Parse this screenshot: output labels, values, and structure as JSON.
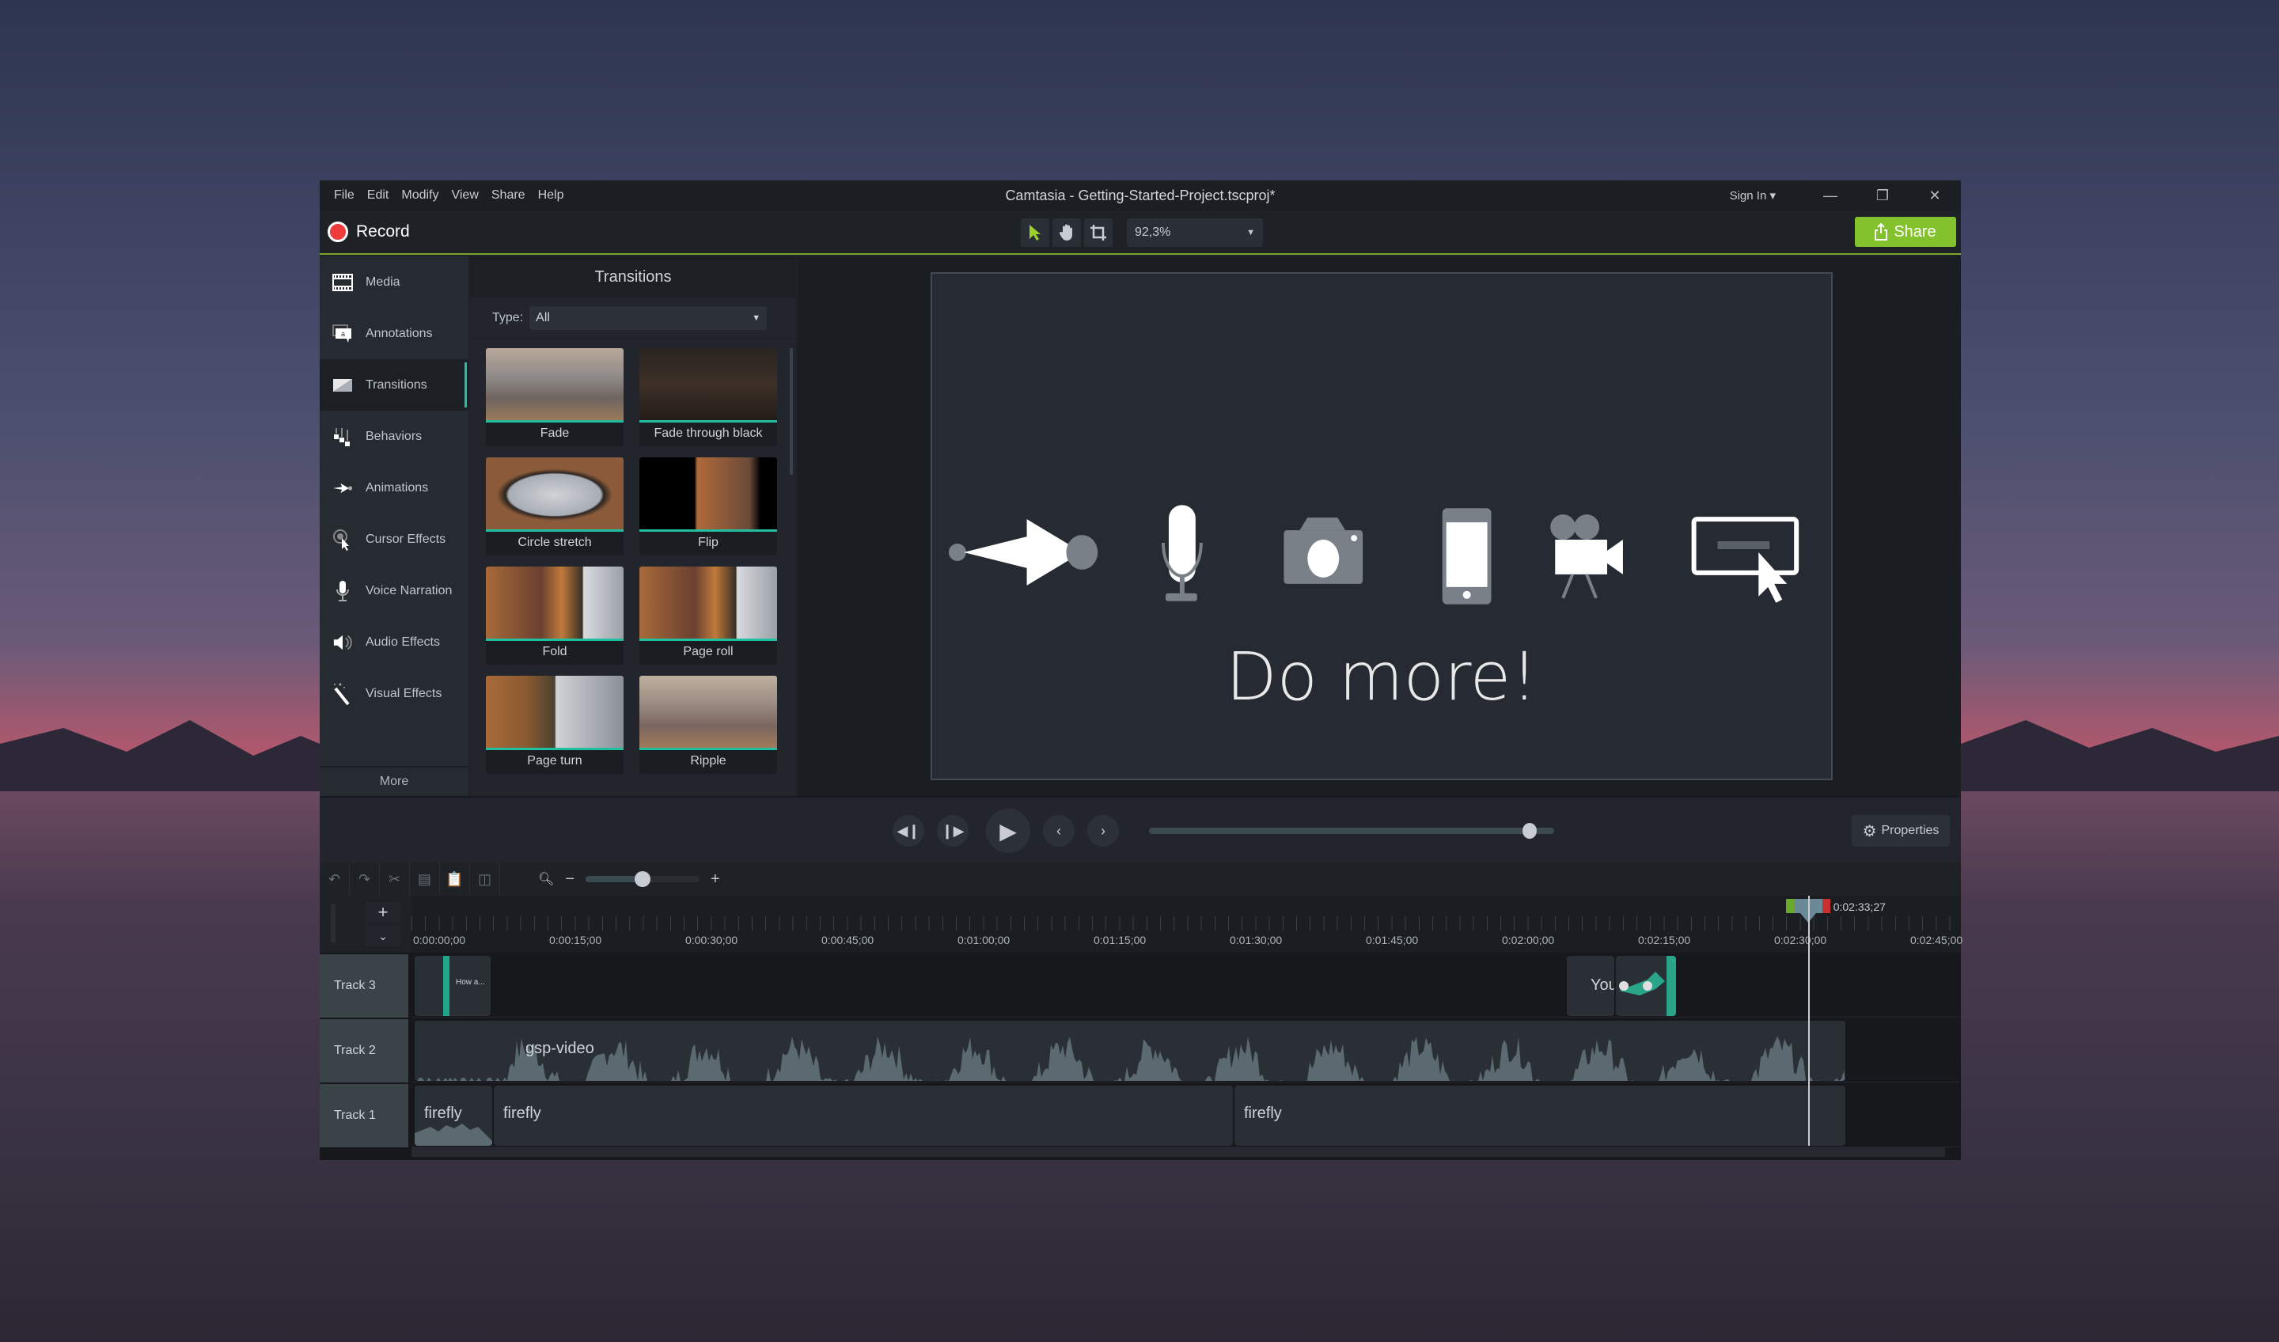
{
  "window": {
    "title": "Camtasia - Getting-Started-Project.tscproj*",
    "menu": [
      "File",
      "Edit",
      "Modify",
      "View",
      "Share",
      "Help"
    ],
    "sign_in": "Sign In ▾",
    "minimize": "—",
    "restore": "❐",
    "close": "✕"
  },
  "toolbar": {
    "record_label": "Record",
    "zoom_value": "92,3%",
    "share_label": "Share",
    "accent_color": "#83c22c"
  },
  "sidebar": {
    "items": [
      {
        "label": "Media",
        "icon": "media-icon"
      },
      {
        "label": "Annotations",
        "icon": "annotations-icon"
      },
      {
        "label": "Transitions",
        "icon": "transitions-icon",
        "active": true
      },
      {
        "label": "Behaviors",
        "icon": "behaviors-icon"
      },
      {
        "label": "Animations",
        "icon": "animations-icon"
      },
      {
        "label": "Cursor Effects",
        "icon": "cursor-effects-icon"
      },
      {
        "label": "Voice Narration",
        "icon": "microphone-icon"
      },
      {
        "label": "Audio Effects",
        "icon": "speaker-icon"
      },
      {
        "label": "Visual Effects",
        "icon": "magic-wand-icon"
      }
    ],
    "more_label": "More"
  },
  "panel": {
    "title": "Transitions",
    "type_label": "Type:",
    "type_value": "All",
    "items": [
      {
        "label": "Fade"
      },
      {
        "label": "Fade through black"
      },
      {
        "label": "Circle stretch"
      },
      {
        "label": "Flip"
      },
      {
        "label": "Fold"
      },
      {
        "label": "Page roll"
      },
      {
        "label": "Page turn"
      },
      {
        "label": "Ripple"
      }
    ]
  },
  "canvas": {
    "headline": "Do more!",
    "icons": [
      "arrow-icon",
      "microphone-icon",
      "camera-icon",
      "phone-icon",
      "video-camera-icon",
      "screen-cursor-icon"
    ]
  },
  "playback": {
    "properties_label": "Properties",
    "scrub_fraction": 0.94
  },
  "timeline": {
    "zoom_fraction": 0.5,
    "playhead_time": "0:02:33;27",
    "ruler_labels": [
      "0:00:00;00",
      "0:00:15;00",
      "0:00:30;00",
      "0:00:45;00",
      "0:01:00;00",
      "0:01:15;00",
      "0:01:30;00",
      "0:01:45;00",
      "0:02:00;00",
      "0:02:15;00",
      "0:02:30;00",
      "0:02:45;00"
    ],
    "tracks": [
      {
        "label": "Track 3",
        "clips": [
          {
            "title": "How a..."
          },
          {
            "title": "You"
          },
          {
            "title": ""
          }
        ]
      },
      {
        "label": "Track 2",
        "clips": [
          {
            "title": "gsp-video"
          }
        ]
      },
      {
        "label": "Track 1",
        "clips": [
          {
            "title": "firefly"
          },
          {
            "title": "firefly"
          },
          {
            "title": "firefly"
          }
        ]
      }
    ]
  }
}
